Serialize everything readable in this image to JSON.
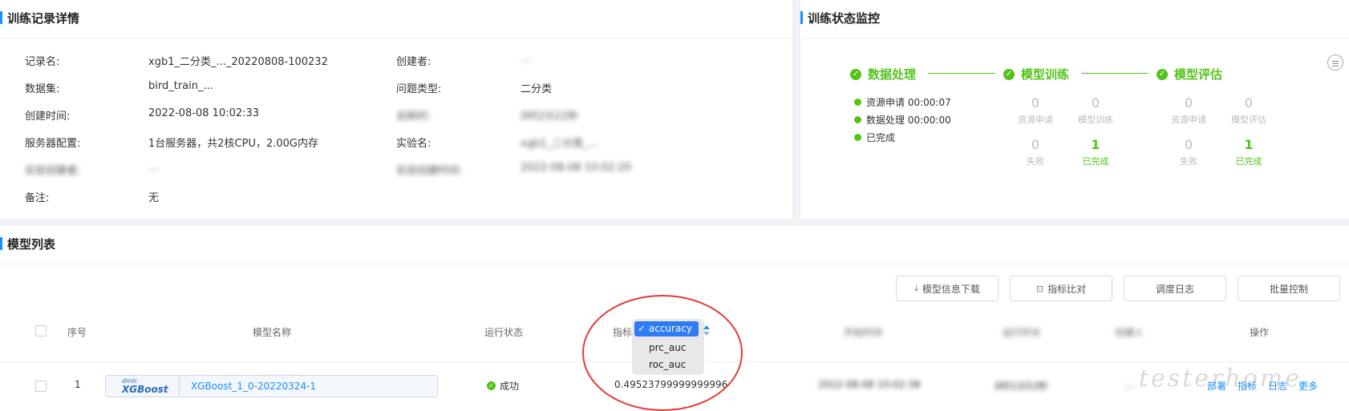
{
  "detail": {
    "title": "训练记录详情",
    "fields": [
      {
        "label": "记录名:",
        "value": "xgb1_二分类_..._20220808-100232"
      },
      {
        "label": "数据集:",
        "value": "bird_train_..."
      },
      {
        "label": "创建时间:",
        "value": "2022-08-08 10:02:33"
      },
      {
        "label": "服务器配置:",
        "value": "1台服务器，共2核CPU，2.00G内存"
      },
      {
        "label": "实验创建者:",
        "value": "..."
      },
      {
        "label": "备注:",
        "value": "无"
      }
    ],
    "fields_right": [
      {
        "label": "创建者:",
        "value": "..."
      },
      {
        "label": "问题类型:",
        "value": "二分类"
      },
      {
        "label": "总耗时:",
        "value": "0时2分22秒"
      },
      {
        "label": "实验名:",
        "value": "xgb1_二分类_..."
      },
      {
        "label": "实验创建时间:",
        "value": "2022-08-08 10:02:20"
      }
    ]
  },
  "monitor": {
    "title": "训练状态监控",
    "stages": [
      "数据处理",
      "模型训练",
      "模型评估"
    ],
    "logs": [
      "资源申请 00:00:07",
      "数据处理 00:00:00",
      "已完成"
    ],
    "train_stats": [
      {
        "num": "0",
        "label": "资源申请"
      },
      {
        "num": "0",
        "label": "模型训练"
      },
      {
        "num": "0",
        "label": "失败"
      },
      {
        "num": "1",
        "label": "已完成"
      }
    ],
    "eval_stats": [
      {
        "num": "0",
        "label": "资源申请"
      },
      {
        "num": "0",
        "label": "模型评估"
      },
      {
        "num": "0",
        "label": "失败"
      },
      {
        "num": "1",
        "label": "已完成"
      }
    ]
  },
  "models": {
    "title": "模型列表",
    "toolbar": [
      "模型信息下载",
      "指标比对",
      "调度日志",
      "批量控制"
    ],
    "headers": {
      "index": "序号",
      "name": "模型名称",
      "status": "运行状态",
      "metric": "指标",
      "start_time": "开始时间",
      "duration": "运行时长",
      "creator": "创建人",
      "actions": "操作"
    },
    "metric_options": [
      "accuracy",
      "prc_auc",
      "roc_auc"
    ],
    "metric_selected": "accuracy",
    "rows": [
      {
        "index": "1",
        "logo_small": "dmlc",
        "logo_big": "XGBoost",
        "name": "XGBoost_1_0-20220324-1",
        "status": "成功",
        "metric_value": "0.49523799999999996",
        "start_time": "2022-08-08 10:02:38",
        "duration": "0时1分52秒",
        "creator": "...",
        "actions": [
          "部署",
          "指标",
          "日志",
          "更多"
        ]
      }
    ]
  },
  "watermark": "testerhome",
  "colors": {
    "accent": "#1890ff",
    "success": "#52c41a",
    "highlight": "#e53935"
  }
}
